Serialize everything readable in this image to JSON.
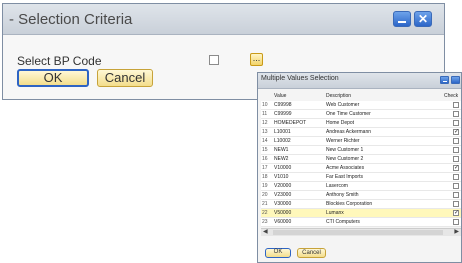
{
  "dialog": {
    "title": "- Selection Criteria",
    "field_label": "Select BP Code",
    "ellipsis_label": "...",
    "ok_label": "OK",
    "cancel_label": "Cancel",
    "minimize_glyph": "",
    "close_glyph": "✕"
  },
  "mvs": {
    "title": "Multiple Values Selection",
    "headers": {
      "value": "Value",
      "description": "Description",
      "check": "Check"
    },
    "rows": [
      {
        "n": "10",
        "value": "C99998",
        "desc": "Web Customer",
        "checked": false
      },
      {
        "n": "11",
        "value": "C99999",
        "desc": "One Time Customer",
        "checked": false
      },
      {
        "n": "12",
        "value": "HOMEDEPOT",
        "desc": "Home Depot",
        "checked": false
      },
      {
        "n": "13",
        "value": "L10001",
        "desc": "Andreas Ackermann",
        "checked": true
      },
      {
        "n": "14",
        "value": "L10002",
        "desc": "Werner Richter",
        "checked": false
      },
      {
        "n": "15",
        "value": "NEW1",
        "desc": "New Customer 1",
        "checked": false
      },
      {
        "n": "16",
        "value": "NEW2",
        "desc": "New Customer 2",
        "checked": false
      },
      {
        "n": "17",
        "value": "V10000",
        "desc": "Acme Associates",
        "checked": true
      },
      {
        "n": "18",
        "value": "V1010",
        "desc": "Far East Imports",
        "checked": false
      },
      {
        "n": "19",
        "value": "V20000",
        "desc": "Lasercom",
        "checked": false
      },
      {
        "n": "20",
        "value": "V23000",
        "desc": "Anthony Smith",
        "checked": false
      },
      {
        "n": "21",
        "value": "V30000",
        "desc": "Blockies Corporation",
        "checked": false
      },
      {
        "n": "22",
        "value": "V50000",
        "desc": "Lumanx",
        "checked": true,
        "selected": true
      },
      {
        "n": "23",
        "value": "V60000",
        "desc": "CTI Computers",
        "checked": false
      }
    ],
    "ok_label": "OK",
    "cancel_label": "Cancel",
    "scroll_left": "◀",
    "scroll_right": "▶"
  },
  "colors": {
    "titlebar_blue": "#2c66c8",
    "button_gold": "#f3dd8c",
    "selected_row": "#fff8bb"
  }
}
